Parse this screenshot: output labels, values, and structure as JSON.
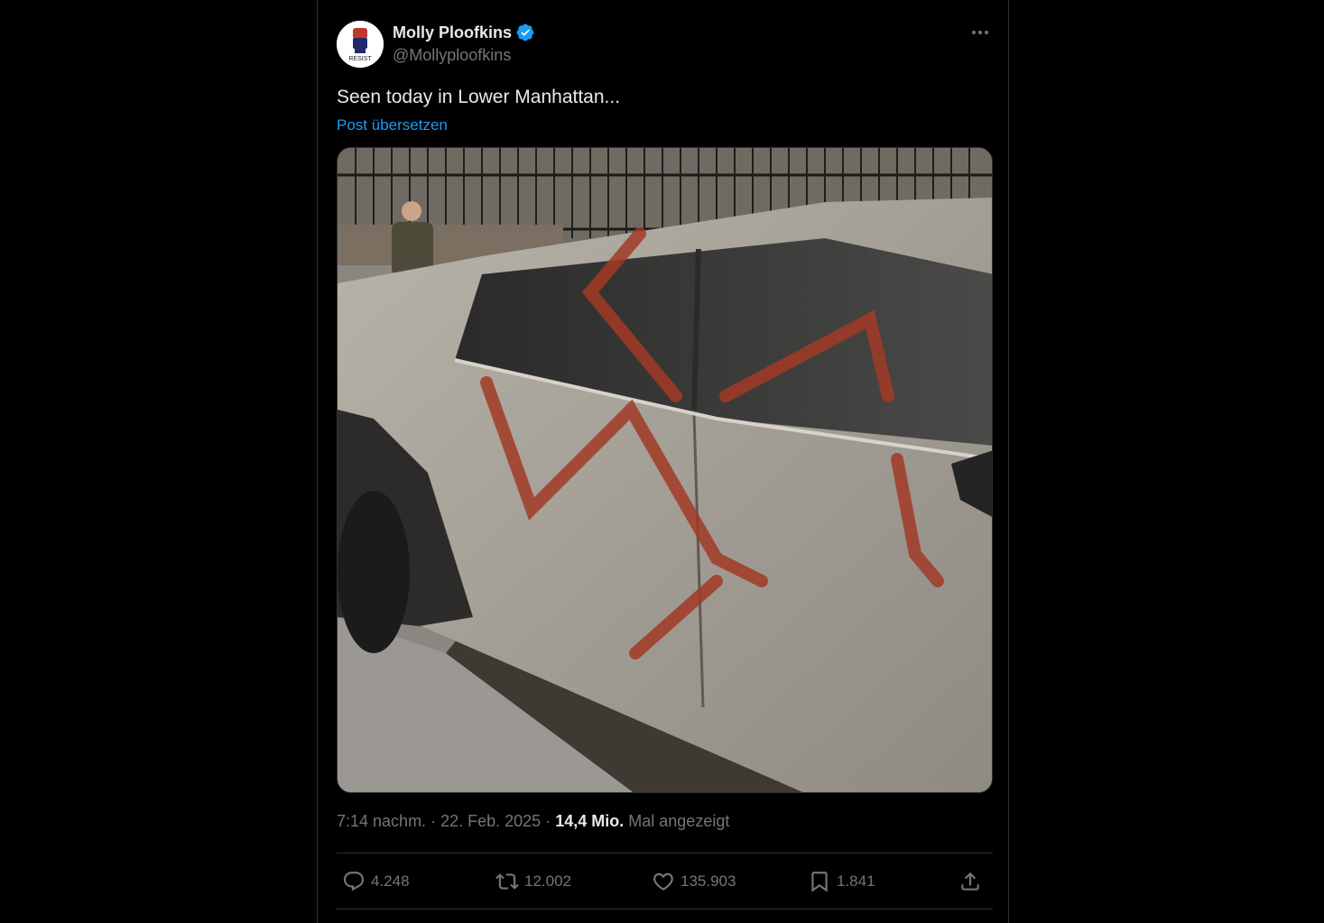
{
  "author": {
    "display_name": "Molly Ploofkins",
    "handle": "@Mollyploofkins",
    "avatar_text": "RESIST",
    "verified": true
  },
  "post": {
    "text": "Seen today in Lower Manhattan...",
    "translate_label": "Post übersetzen"
  },
  "meta": {
    "time": "7:14 nachm.",
    "separator": "·",
    "date": "22. Feb. 2025",
    "views_count": "14,4 Mio.",
    "views_label": "Mal angezeigt"
  },
  "actions": {
    "replies": "4.248",
    "reposts": "12.002",
    "likes": "135.903",
    "bookmarks": "1.841"
  },
  "icons": {
    "more": "more-horizontal-icon",
    "verified": "verified-badge-icon",
    "reply": "reply-icon",
    "repost": "repost-icon",
    "like": "heart-icon",
    "bookmark": "bookmark-icon",
    "share": "share-icon"
  },
  "colors": {
    "background": "#000000",
    "text_primary": "#e7e9ea",
    "text_secondary": "#71767b",
    "link": "#1d9bf0",
    "verified": "#1d9bf0",
    "border": "#2f3336"
  }
}
